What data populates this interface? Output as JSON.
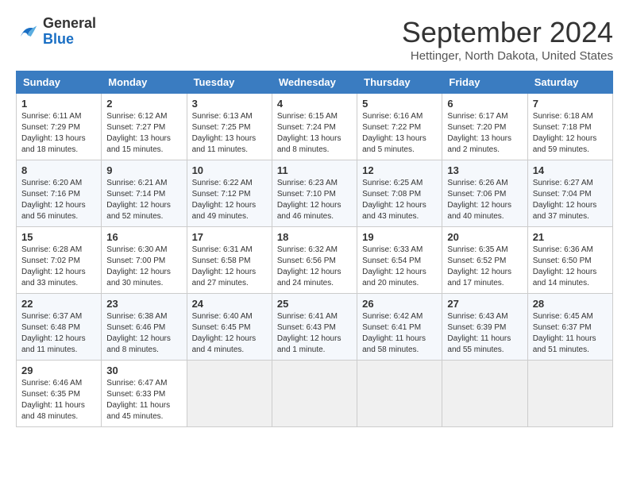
{
  "logo": {
    "line1": "General",
    "line2": "Blue"
  },
  "title": "September 2024",
  "location": "Hettinger, North Dakota, United States",
  "headers": [
    "Sunday",
    "Monday",
    "Tuesday",
    "Wednesday",
    "Thursday",
    "Friday",
    "Saturday"
  ],
  "weeks": [
    [
      {
        "day": "1",
        "info": "Sunrise: 6:11 AM\nSunset: 7:29 PM\nDaylight: 13 hours and 18 minutes."
      },
      {
        "day": "2",
        "info": "Sunrise: 6:12 AM\nSunset: 7:27 PM\nDaylight: 13 hours and 15 minutes."
      },
      {
        "day": "3",
        "info": "Sunrise: 6:13 AM\nSunset: 7:25 PM\nDaylight: 13 hours and 11 minutes."
      },
      {
        "day": "4",
        "info": "Sunrise: 6:15 AM\nSunset: 7:24 PM\nDaylight: 13 hours and 8 minutes."
      },
      {
        "day": "5",
        "info": "Sunrise: 6:16 AM\nSunset: 7:22 PM\nDaylight: 13 hours and 5 minutes."
      },
      {
        "day": "6",
        "info": "Sunrise: 6:17 AM\nSunset: 7:20 PM\nDaylight: 13 hours and 2 minutes."
      },
      {
        "day": "7",
        "info": "Sunrise: 6:18 AM\nSunset: 7:18 PM\nDaylight: 12 hours and 59 minutes."
      }
    ],
    [
      {
        "day": "8",
        "info": "Sunrise: 6:20 AM\nSunset: 7:16 PM\nDaylight: 12 hours and 56 minutes."
      },
      {
        "day": "9",
        "info": "Sunrise: 6:21 AM\nSunset: 7:14 PM\nDaylight: 12 hours and 52 minutes."
      },
      {
        "day": "10",
        "info": "Sunrise: 6:22 AM\nSunset: 7:12 PM\nDaylight: 12 hours and 49 minutes."
      },
      {
        "day": "11",
        "info": "Sunrise: 6:23 AM\nSunset: 7:10 PM\nDaylight: 12 hours and 46 minutes."
      },
      {
        "day": "12",
        "info": "Sunrise: 6:25 AM\nSunset: 7:08 PM\nDaylight: 12 hours and 43 minutes."
      },
      {
        "day": "13",
        "info": "Sunrise: 6:26 AM\nSunset: 7:06 PM\nDaylight: 12 hours and 40 minutes."
      },
      {
        "day": "14",
        "info": "Sunrise: 6:27 AM\nSunset: 7:04 PM\nDaylight: 12 hours and 37 minutes."
      }
    ],
    [
      {
        "day": "15",
        "info": "Sunrise: 6:28 AM\nSunset: 7:02 PM\nDaylight: 12 hours and 33 minutes."
      },
      {
        "day": "16",
        "info": "Sunrise: 6:30 AM\nSunset: 7:00 PM\nDaylight: 12 hours and 30 minutes."
      },
      {
        "day": "17",
        "info": "Sunrise: 6:31 AM\nSunset: 6:58 PM\nDaylight: 12 hours and 27 minutes."
      },
      {
        "day": "18",
        "info": "Sunrise: 6:32 AM\nSunset: 6:56 PM\nDaylight: 12 hours and 24 minutes."
      },
      {
        "day": "19",
        "info": "Sunrise: 6:33 AM\nSunset: 6:54 PM\nDaylight: 12 hours and 20 minutes."
      },
      {
        "day": "20",
        "info": "Sunrise: 6:35 AM\nSunset: 6:52 PM\nDaylight: 12 hours and 17 minutes."
      },
      {
        "day": "21",
        "info": "Sunrise: 6:36 AM\nSunset: 6:50 PM\nDaylight: 12 hours and 14 minutes."
      }
    ],
    [
      {
        "day": "22",
        "info": "Sunrise: 6:37 AM\nSunset: 6:48 PM\nDaylight: 12 hours and 11 minutes."
      },
      {
        "day": "23",
        "info": "Sunrise: 6:38 AM\nSunset: 6:46 PM\nDaylight: 12 hours and 8 minutes."
      },
      {
        "day": "24",
        "info": "Sunrise: 6:40 AM\nSunset: 6:45 PM\nDaylight: 12 hours and 4 minutes."
      },
      {
        "day": "25",
        "info": "Sunrise: 6:41 AM\nSunset: 6:43 PM\nDaylight: 12 hours and 1 minute."
      },
      {
        "day": "26",
        "info": "Sunrise: 6:42 AM\nSunset: 6:41 PM\nDaylight: 11 hours and 58 minutes."
      },
      {
        "day": "27",
        "info": "Sunrise: 6:43 AM\nSunset: 6:39 PM\nDaylight: 11 hours and 55 minutes."
      },
      {
        "day": "28",
        "info": "Sunrise: 6:45 AM\nSunset: 6:37 PM\nDaylight: 11 hours and 51 minutes."
      }
    ],
    [
      {
        "day": "29",
        "info": "Sunrise: 6:46 AM\nSunset: 6:35 PM\nDaylight: 11 hours and 48 minutes."
      },
      {
        "day": "30",
        "info": "Sunrise: 6:47 AM\nSunset: 6:33 PM\nDaylight: 11 hours and 45 minutes."
      },
      {
        "day": "",
        "info": ""
      },
      {
        "day": "",
        "info": ""
      },
      {
        "day": "",
        "info": ""
      },
      {
        "day": "",
        "info": ""
      },
      {
        "day": "",
        "info": ""
      }
    ]
  ]
}
